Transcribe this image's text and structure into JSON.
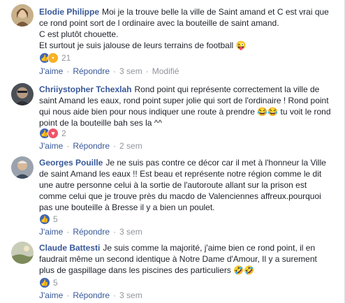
{
  "comments": [
    {
      "author": "Elodie Philippe",
      "text": "Moi je la trouve belle la ville de Saint amand et C est vrai que ce rond point sort de l ordinaire avec la bouteille de saint amand.\nC est plutôt chouette.\nEt surtout je suis jalouse de leurs terrains de football",
      "emoji": "😜",
      "reaction_icons": [
        "like-icon",
        "wow-icon"
      ],
      "reaction_count": "21",
      "like_label": "J'aime",
      "reply_label": "Répondre",
      "time": "3 sem",
      "edited": "Modifié"
    },
    {
      "author": "Chriiystopher Tchexlah",
      "text": "Rond point qui représente correctement la ville de saint Amand les eaux, rond point super jolie qui sort de l'ordinaire ! Rond point qui nous aide bien pour nous indiquer une route à prendre",
      "emoji": "😂😂",
      "text_after": "tu voit le rond point de la bouteille bah ses la ^^",
      "reaction_icons": [
        "like-icon",
        "love-icon"
      ],
      "reaction_count": "2",
      "like_label": "J'aime",
      "reply_label": "Répondre",
      "time": "2 sem"
    },
    {
      "author": "Georges Pouille",
      "text": "Je ne suis pas contre ce décor car il met à l'honneur la Ville de saint Amand les eaux !! Est beau et représente notre région comme le dit une autre personne celui à la sortie de l'autoroute allant sur la prison est comme celui que je trouve près du macdo de Valenciennes affreux.pourquoi pas une bouteille à Bresse il y a bien un poulet.",
      "reaction_icons": [
        "like-icon"
      ],
      "reaction_count": "5",
      "like_label": "J'aime",
      "reply_label": "Répondre",
      "time": "3 sem"
    },
    {
      "author": "Claude Battesti",
      "text": "Je suis comme la majorité, j'aime bien ce rond point, il en faudrait même un second identique à Notre Dame d'Amour, Il y a surement plus de gaspillage dans les piscines des particuliers",
      "emoji": "🤣🤣",
      "reaction_icons": [
        "like-icon"
      ],
      "reaction_count": "5",
      "like_label": "J'aime",
      "reply_label": "Répondre",
      "time": "3 sem"
    }
  ]
}
